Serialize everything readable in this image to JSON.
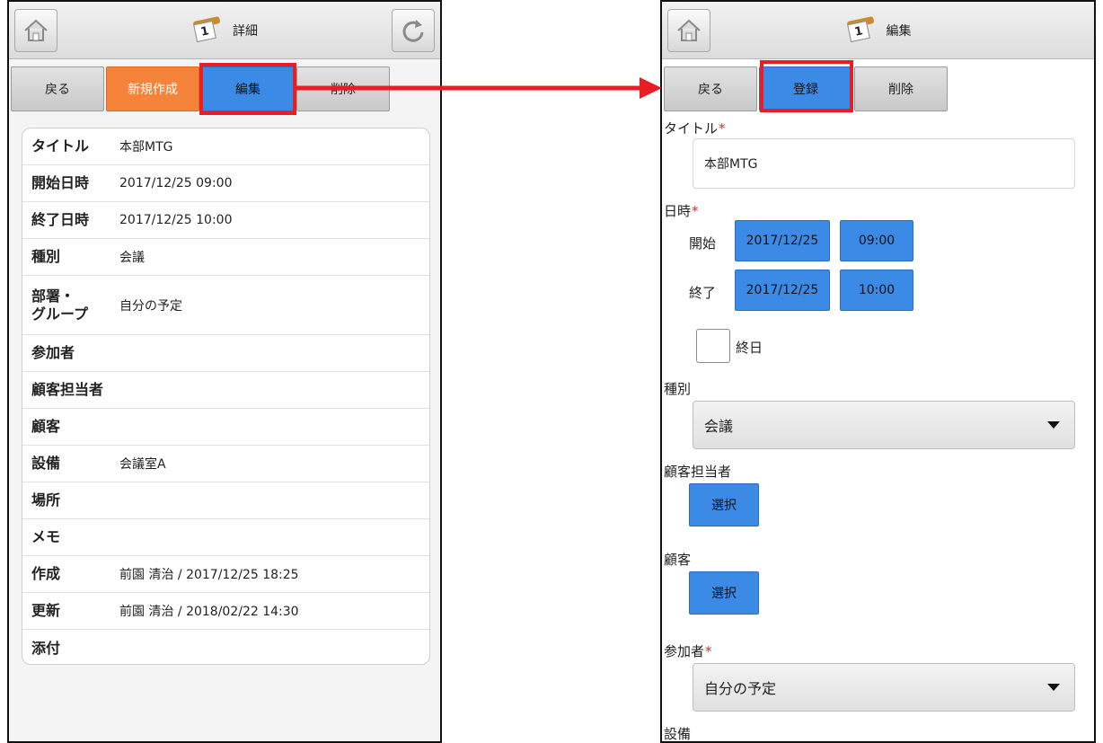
{
  "left": {
    "title": "詳細",
    "buttons": [
      "戻る",
      "新規作成",
      "編集",
      "削除"
    ],
    "rows": [
      {
        "label": "タイトル",
        "value": "本部MTG"
      },
      {
        "label": "開始日時",
        "value": "2017/12/25 09:00"
      },
      {
        "label": "終了日時",
        "value": "2017/12/25 10:00"
      },
      {
        "label": "種別",
        "value": "会議"
      },
      {
        "label": "部署・\nグループ",
        "value": "自分の予定"
      },
      {
        "label": "参加者",
        "value": ""
      },
      {
        "label": "顧客担当者",
        "value": ""
      },
      {
        "label": "顧客",
        "value": ""
      },
      {
        "label": "設備",
        "value": "会議室A"
      },
      {
        "label": "場所",
        "value": ""
      },
      {
        "label": "メモ",
        "value": ""
      },
      {
        "label": "作成",
        "value": "前園 清治 / 2017/12/25 18:25"
      },
      {
        "label": "更新",
        "value": "前園 清治 / 2018/02/22 14:30"
      },
      {
        "label": "添付",
        "value": ""
      }
    ]
  },
  "right": {
    "title": "編集",
    "buttons": [
      "戻る",
      "登録",
      "削除"
    ],
    "form": {
      "title_label": "タイトル",
      "title_value": "本部MTG",
      "datetime_label": "日時",
      "start_label": "開始",
      "start_date": "2017/12/25",
      "start_time": "09:00",
      "end_label": "終了",
      "end_date": "2017/12/25",
      "end_time": "10:00",
      "allday_label": "終日",
      "type_label": "種別",
      "type_value": "会議",
      "cust_owner_label": "顧客担当者",
      "select_button": "選択",
      "customer_label": "顧客",
      "participants_label": "参加者",
      "participants_value": "自分の予定",
      "equipment_label": "設備",
      "required_mark": "*"
    }
  },
  "colors": {
    "accent_blue": "#3b8be6",
    "orange": "#f5843a",
    "highlight_red": "#ea1c24"
  }
}
